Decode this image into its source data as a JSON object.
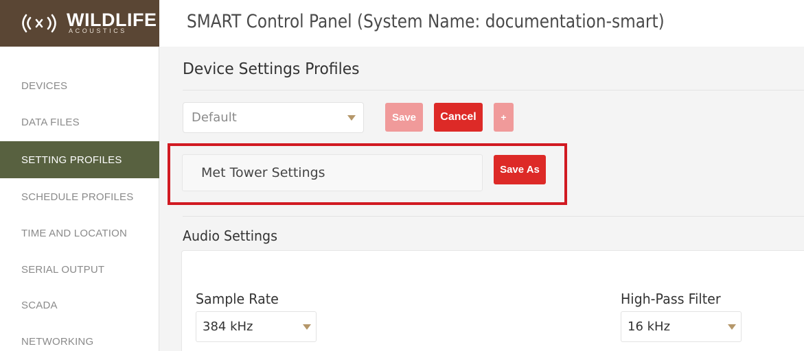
{
  "brand": {
    "logo_text": "WILDLIFE",
    "logo_subtext": "ACOUSTICS",
    "colors": {
      "logo_bg": "#5a4634",
      "accent_red": "#dd2a27",
      "active_nav": "#586140",
      "highlight": "#d11a22"
    }
  },
  "header": {
    "title": "SMART Control Panel  (System Name:  documentation-smart)"
  },
  "sidebar": {
    "items": [
      {
        "label": "DEVICES",
        "active": false
      },
      {
        "label": "DATA FILES",
        "active": false
      },
      {
        "label": "SETTING PROFILES",
        "active": true
      },
      {
        "label": "SCHEDULE PROFILES",
        "active": false
      },
      {
        "label": "TIME AND LOCATION",
        "active": false
      },
      {
        "label": "SERIAL OUTPUT",
        "active": false
      },
      {
        "label": "SCADA",
        "active": false
      },
      {
        "label": "NETWORKING",
        "active": false
      }
    ]
  },
  "main": {
    "section_title": "Device Settings Profiles",
    "profile_select": {
      "value": "Default",
      "icon": "chevron-down-icon"
    },
    "buttons": {
      "save": "Save",
      "cancel": "Cancel",
      "add": "+",
      "save_as": "Save As"
    },
    "profile_name_input": {
      "value": "Met Tower Settings"
    },
    "audio": {
      "title": "Audio Settings",
      "sample_rate": {
        "label": "Sample Rate",
        "value": "384 kHz"
      },
      "high_pass_filter": {
        "label": "High-Pass Filter",
        "value": "16 kHz"
      }
    }
  }
}
